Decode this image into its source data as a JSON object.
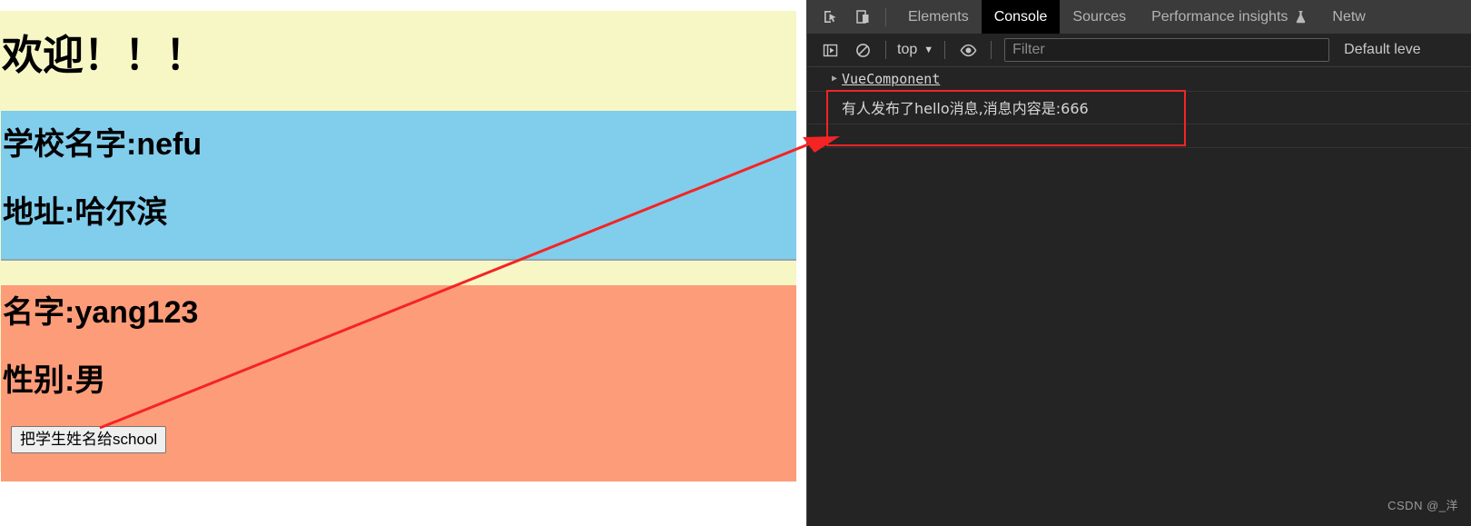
{
  "webpage": {
    "welcome_title": "欢迎！！！",
    "school": {
      "name_line": "学校名字:nefu",
      "address_line": "地址:哈尔滨"
    },
    "student": {
      "name_line": "名字:yang123",
      "sex_line": "性别:男",
      "button_label": "把学生姓名给school"
    },
    "colors": {
      "outer_background": "#f7f7c6",
      "school_background": "#81cdec",
      "student_background": "#fd9c79",
      "button_background": "#efefef"
    }
  },
  "devtools": {
    "tabs": [
      {
        "label": "Elements",
        "active": false,
        "experiment": false
      },
      {
        "label": "Console",
        "active": true,
        "experiment": false
      },
      {
        "label": "Sources",
        "active": false,
        "experiment": false
      },
      {
        "label": "Performance insights",
        "active": false,
        "experiment": true
      },
      {
        "label": "Netw",
        "active": false,
        "experiment": false
      }
    ],
    "toolbar": {
      "context_label": "top",
      "context_caret": "▼",
      "filter_placeholder": "Filter",
      "filter_value": "",
      "level_label": "Default leve"
    },
    "icons": {
      "inspect": "inspect-element-icon",
      "device": "device-toolbar-icon",
      "sidebar": "console-sidebar-icon",
      "clear": "clear-console-icon",
      "eye": "live-expression-icon",
      "experiment": "experiment-flask-icon"
    },
    "console": {
      "rows": [
        {
          "type": "object",
          "disclosure": "▶",
          "text": "VueComponent"
        },
        {
          "type": "message",
          "text": "有人发布了hello消息,消息内容是:666"
        },
        {
          "type": "blank",
          "text": ""
        }
      ]
    }
  },
  "annotation": {
    "color": "#f42424",
    "highlight_box_label": "console-message-highlight",
    "arrow_label": "annotation-arrow"
  },
  "watermark": {
    "text": "CSDN @_洋"
  }
}
